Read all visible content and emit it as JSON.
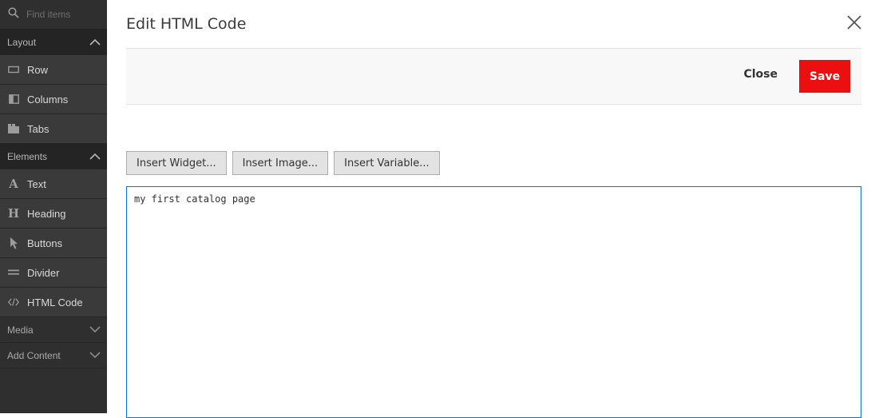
{
  "sidebar": {
    "search_placeholder": "Find items",
    "sections": [
      {
        "label": "Layout",
        "state": "expanded",
        "items": [
          {
            "label": "Row",
            "icon": "row-icon"
          },
          {
            "label": "Columns",
            "icon": "columns-icon"
          },
          {
            "label": "Tabs",
            "icon": "tabs-icon"
          }
        ]
      },
      {
        "label": "Elements",
        "state": "expanded",
        "items": [
          {
            "label": "Text",
            "icon": "text-icon",
            "glyph": "A"
          },
          {
            "label": "Heading",
            "icon": "heading-icon",
            "glyph": "H"
          },
          {
            "label": "Buttons",
            "icon": "cursor-icon"
          },
          {
            "label": "Divider",
            "icon": "divider-icon"
          },
          {
            "label": "HTML Code",
            "icon": "code-icon"
          }
        ]
      },
      {
        "label": "Media",
        "state": "collapsed"
      },
      {
        "label": "Add Content",
        "state": "collapsed"
      }
    ]
  },
  "modal": {
    "title": "Edit HTML Code",
    "close_label": "Close",
    "save_label": "Save",
    "insert_buttons": [
      "Insert Widget...",
      "Insert Image...",
      "Insert Variable..."
    ],
    "editor_value": "my first catalog page"
  },
  "colors": {
    "sidebar_bg": "#2f2f2f",
    "save_button": "#eb0f0f",
    "editor_focus_border": "#007bdb"
  }
}
